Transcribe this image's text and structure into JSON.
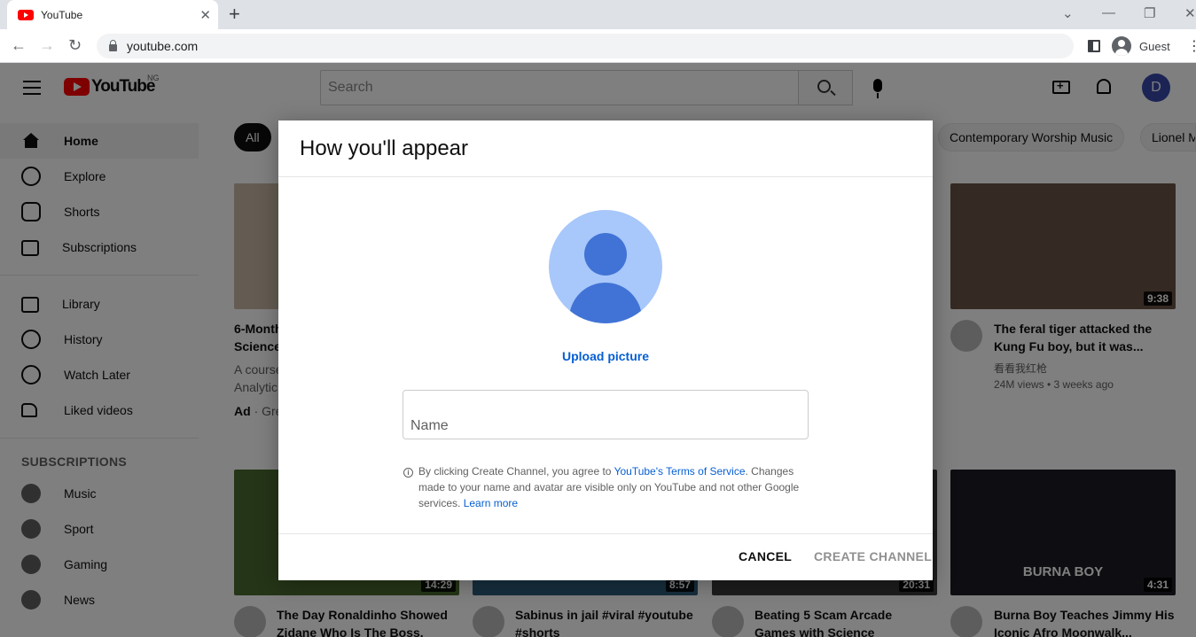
{
  "browser": {
    "tab_title": "YouTube",
    "tab_close": "✕",
    "new_tab": "+",
    "window_controls": [
      "⌄",
      "—",
      "❐",
      "✕"
    ],
    "url": "youtube.com",
    "profile_label": "Guest",
    "menu_glyph": "⋮"
  },
  "youtube": {
    "logo_word": "YouTube",
    "country_code": "NG",
    "search_placeholder": "Search",
    "avatar_letter": "D",
    "sidebar": {
      "items": [
        {
          "label": "Home",
          "icon": "home-icon"
        },
        {
          "label": "Explore",
          "icon": "compass-icon"
        },
        {
          "label": "Shorts",
          "icon": "shorts-icon"
        },
        {
          "label": "Subscriptions",
          "icon": "subscriptions-icon"
        },
        {
          "label": "Library",
          "icon": "library-icon"
        },
        {
          "label": "History",
          "icon": "history-icon"
        },
        {
          "label": "Watch Later",
          "icon": "clock-icon"
        },
        {
          "label": "Liked videos",
          "icon": "thumbs-up-icon"
        }
      ],
      "subscriptions_heading": "SUBSCRIPTIONS",
      "subscriptions": [
        {
          "label": "Music"
        },
        {
          "label": "Sport"
        },
        {
          "label": "Gaming"
        },
        {
          "label": "News"
        }
      ]
    },
    "chips": {
      "all": "All",
      "worship": "Contemporary Worship Music",
      "lionel": "Lionel M"
    },
    "cards": {
      "ad": {
        "title": "6-Month... Science...",
        "line1": "6-Month",
        "line2": "Science",
        "desc1": "A course",
        "desc2": "Analytic",
        "ad_badge": "Ad",
        "channel": "Gre"
      },
      "tiger": {
        "title": "The feral tiger attacked the Kung Fu boy, but it was...",
        "channel": "看看我红枪",
        "meta": "24M views • 3 weeks ago",
        "duration": "9:38"
      },
      "ronaldinho": {
        "title": "The Day Ronaldinho Showed Zidane Who Is The Boss.",
        "duration": "14:29"
      },
      "sabinus": {
        "title": "Sabinus in jail #viral #youtube #shorts",
        "duration": "8:57"
      },
      "arcade": {
        "title": "Beating 5 Scam Arcade Games with Science",
        "duration": "20:31"
      },
      "burna": {
        "title": "Burna Boy Teaches Jimmy His Iconic Afro Moonwalk...",
        "duration": "4:31",
        "thumb_text": "BURNA BOY"
      }
    }
  },
  "dialog": {
    "title": "How you'll appear",
    "upload_label": "Upload picture",
    "name_placeholder": "Name",
    "name_value": "",
    "info_glyph": "i",
    "consent_prefix": "By clicking Create Channel, you agree to ",
    "consent_link": "YouTube's Terms of Service",
    "consent_suffix": ". Changes made to your name and avatar are visible only on YouTube and not other Google services. ",
    "learn_more": "Learn more",
    "cancel_label": "CANCEL",
    "create_label": "CREATE CHANNEL"
  }
}
